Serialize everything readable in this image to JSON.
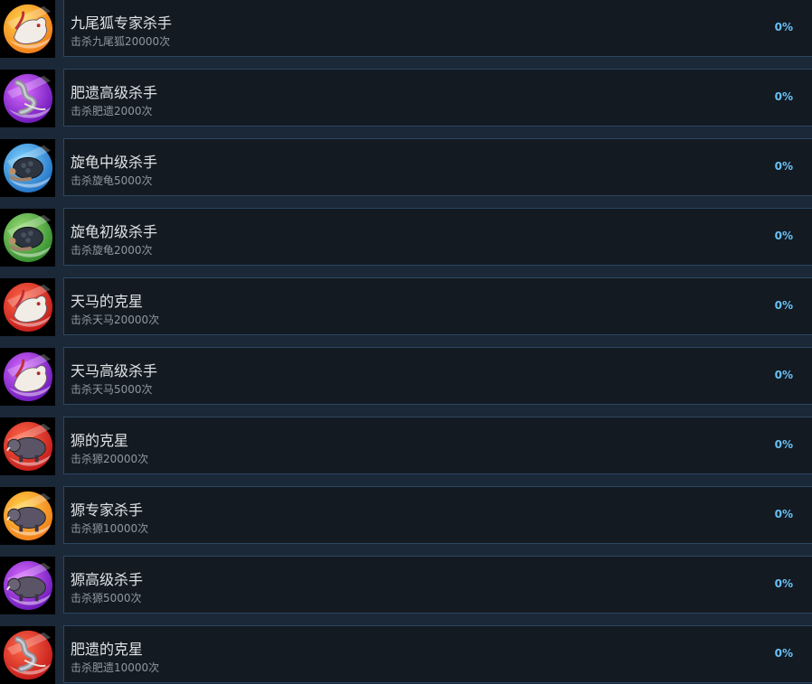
{
  "achievements": [
    {
      "title": "九尾狐专家杀手",
      "desc": "击杀九尾狐20000次",
      "percent": "0%",
      "icon": "nine-tailed-fox-icon",
      "theme": {
        "c1": "#ffd64a",
        "c2": "#f07a18"
      },
      "creature": "fox"
    },
    {
      "title": "肥遗高级杀手",
      "desc": "击杀肥遗2000次",
      "percent": "0%",
      "icon": "feiyi-serpent-icon",
      "theme": {
        "c1": "#d96cff",
        "c2": "#6a16b8"
      },
      "creature": "serpent"
    },
    {
      "title": "旋龟中级杀手",
      "desc": "击杀旋龟5000次",
      "percent": "0%",
      "icon": "xuan-turtle-icon",
      "theme": {
        "c1": "#7fd4ff",
        "c2": "#1f6fc4"
      },
      "creature": "turtle"
    },
    {
      "title": "旋龟初级杀手",
      "desc": "击杀旋龟2000次",
      "percent": "0%",
      "icon": "xuan-turtle-icon",
      "theme": {
        "c1": "#9fe07a",
        "c2": "#2f8a2a"
      },
      "creature": "turtle"
    },
    {
      "title": "天马的克星",
      "desc": "击杀天马20000次",
      "percent": "0%",
      "icon": "tianma-horse-icon",
      "theme": {
        "c1": "#ff6a4a",
        "c2": "#c21818"
      },
      "creature": "fox"
    },
    {
      "title": "天马高级杀手",
      "desc": "击杀天马5000次",
      "percent": "0%",
      "icon": "tianma-horse-icon",
      "theme": {
        "c1": "#d96cff",
        "c2": "#6a16b8"
      },
      "creature": "fox"
    },
    {
      "title": "獂的克星",
      "desc": "击杀獂20000次",
      "percent": "0%",
      "icon": "huan-beast-icon",
      "theme": {
        "c1": "#ff6a4a",
        "c2": "#c21818"
      },
      "creature": "boar"
    },
    {
      "title": "獂专家杀手",
      "desc": "击杀獂10000次",
      "percent": "0%",
      "icon": "huan-beast-icon",
      "theme": {
        "c1": "#ffd64a",
        "c2": "#f07a18"
      },
      "creature": "boar"
    },
    {
      "title": "獂高级杀手",
      "desc": "击杀獂5000次",
      "percent": "0%",
      "icon": "huan-beast-icon",
      "theme": {
        "c1": "#d96cff",
        "c2": "#6a16b8"
      },
      "creature": "boar"
    },
    {
      "title": "肥遗的克星",
      "desc": "击杀肥遗10000次",
      "percent": "0%",
      "icon": "feiyi-serpent-icon",
      "theme": {
        "c1": "#ff6a4a",
        "c2": "#c21818"
      },
      "creature": "serpent"
    }
  ]
}
